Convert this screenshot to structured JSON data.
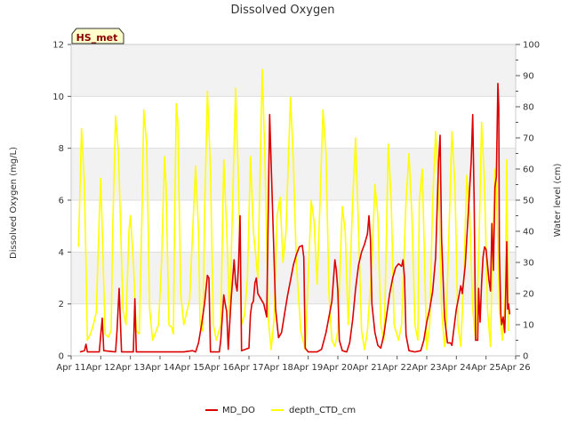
{
  "chart_data": {
    "type": "line",
    "title": "Dissolved Oxygen",
    "badge": "HS_met",
    "ylabel": "Dissolved Oxygen (mg/L)",
    "y2label": "Water level (cm)",
    "ylim": [
      0,
      12
    ],
    "y2lim": [
      0,
      100
    ],
    "xlim": [
      0,
      15
    ],
    "yticks": [
      "0",
      "2",
      "4",
      "6",
      "8",
      "10",
      "12"
    ],
    "y2ticks": [
      "0",
      "10",
      "20",
      "30",
      "40",
      "50",
      "60",
      "70",
      "80",
      "90",
      "100"
    ],
    "xticks": [
      "Apr 11",
      "Apr 12",
      "Apr 13",
      "Apr 14",
      "Apr 15",
      "Apr 16",
      "Apr 17",
      "Apr 18",
      "Apr 19",
      "Apr 20",
      "Apr 21",
      "Apr 22",
      "Apr 23",
      "Apr 24",
      "Apr 25",
      "Apr 26"
    ],
    "legend_position": "bottom-center",
    "series": [
      {
        "name": "MD_DO",
        "axis": "left",
        "color": "#dd0000",
        "points": [
          [
            0.3,
            0.15
          ],
          [
            0.45,
            0.2
          ],
          [
            0.5,
            0.45
          ],
          [
            0.55,
            0.15
          ],
          [
            0.8,
            0.15
          ],
          [
            0.95,
            0.15
          ],
          [
            1.0,
            0.8
          ],
          [
            1.05,
            1.45
          ],
          [
            1.1,
            0.2
          ],
          [
            1.5,
            0.15
          ],
          [
            1.55,
            1.0
          ],
          [
            1.62,
            2.6
          ],
          [
            1.7,
            0.15
          ],
          [
            2.0,
            0.15
          ],
          [
            2.1,
            0.15
          ],
          [
            2.15,
            2.2
          ],
          [
            2.2,
            0.15
          ],
          [
            2.5,
            0.15
          ],
          [
            3.0,
            0.15
          ],
          [
            3.5,
            0.15
          ],
          [
            3.8,
            0.15
          ],
          [
            4.1,
            0.2
          ],
          [
            4.2,
            0.15
          ],
          [
            4.3,
            0.5
          ],
          [
            4.4,
            1.2
          ],
          [
            4.5,
            2.0
          ],
          [
            4.6,
            3.1
          ],
          [
            4.65,
            3.0
          ],
          [
            4.7,
            0.15
          ],
          [
            5.0,
            0.15
          ],
          [
            5.05,
            0.6
          ],
          [
            5.15,
            2.35
          ],
          [
            5.2,
            2.0
          ],
          [
            5.25,
            1.7
          ],
          [
            5.3,
            0.25
          ],
          [
            5.4,
            2.2
          ],
          [
            5.5,
            3.7
          ],
          [
            5.55,
            2.8
          ],
          [
            5.6,
            2.5
          ],
          [
            5.65,
            3.5
          ],
          [
            5.7,
            5.4
          ],
          [
            5.75,
            0.2
          ],
          [
            6.0,
            0.3
          ],
          [
            6.05,
            1.6
          ],
          [
            6.1,
            2.0
          ],
          [
            6.15,
            2.1
          ],
          [
            6.2,
            2.8
          ],
          [
            6.25,
            3.0
          ],
          [
            6.3,
            2.4
          ],
          [
            6.4,
            2.2
          ],
          [
            6.5,
            2.0
          ],
          [
            6.6,
            1.5
          ],
          [
            6.7,
            9.3
          ],
          [
            6.8,
            5.5
          ],
          [
            6.9,
            1.8
          ],
          [
            7.0,
            0.7
          ],
          [
            7.1,
            0.9
          ],
          [
            7.2,
            1.6
          ],
          [
            7.3,
            2.3
          ],
          [
            7.4,
            2.9
          ],
          [
            7.5,
            3.5
          ],
          [
            7.6,
            3.9
          ],
          [
            7.7,
            4.2
          ],
          [
            7.8,
            4.25
          ],
          [
            7.85,
            3.8
          ],
          [
            7.9,
            0.3
          ],
          [
            8.0,
            0.15
          ],
          [
            8.3,
            0.15
          ],
          [
            8.45,
            0.25
          ],
          [
            8.6,
            0.9
          ],
          [
            8.7,
            1.5
          ],
          [
            8.8,
            2.1
          ],
          [
            8.85,
            2.9
          ],
          [
            8.9,
            3.7
          ],
          [
            8.95,
            3.3
          ],
          [
            9.0,
            2.5
          ],
          [
            9.05,
            0.6
          ],
          [
            9.15,
            0.2
          ],
          [
            9.3,
            0.15
          ],
          [
            9.4,
            0.5
          ],
          [
            9.5,
            1.4
          ],
          [
            9.6,
            2.6
          ],
          [
            9.7,
            3.5
          ],
          [
            9.8,
            4.0
          ],
          [
            9.9,
            4.3
          ],
          [
            10.0,
            4.7
          ],
          [
            10.05,
            5.4
          ],
          [
            10.1,
            4.5
          ],
          [
            10.15,
            2.0
          ],
          [
            10.25,
            0.9
          ],
          [
            10.35,
            0.4
          ],
          [
            10.45,
            0.3
          ],
          [
            10.55,
            0.8
          ],
          [
            10.65,
            1.6
          ],
          [
            10.75,
            2.4
          ],
          [
            10.85,
            3.0
          ],
          [
            10.95,
            3.4
          ],
          [
            11.05,
            3.55
          ],
          [
            11.15,
            3.45
          ],
          [
            11.2,
            3.7
          ],
          [
            11.25,
            3.0
          ],
          [
            11.3,
            0.8
          ],
          [
            11.4,
            0.2
          ],
          [
            11.6,
            0.15
          ],
          [
            11.8,
            0.2
          ],
          [
            11.9,
            0.6
          ],
          [
            12.0,
            1.3
          ],
          [
            12.1,
            1.8
          ],
          [
            12.2,
            2.5
          ],
          [
            12.3,
            3.8
          ],
          [
            12.4,
            7.5
          ],
          [
            12.45,
            8.5
          ],
          [
            12.5,
            4.5
          ],
          [
            12.6,
            1.5
          ],
          [
            12.7,
            0.5
          ],
          [
            12.8,
            0.5
          ],
          [
            12.85,
            0.4
          ],
          [
            12.9,
            0.9
          ],
          [
            13.0,
            1.8
          ],
          [
            13.1,
            2.4
          ],
          [
            13.15,
            2.7
          ],
          [
            13.2,
            2.4
          ],
          [
            13.3,
            3.5
          ],
          [
            13.4,
            5.5
          ],
          [
            13.45,
            6.5
          ],
          [
            13.5,
            7.5
          ],
          [
            13.55,
            9.3
          ],
          [
            13.6,
            6.0
          ],
          [
            13.65,
            0.6
          ],
          [
            13.72,
            0.6
          ],
          [
            13.75,
            2.6
          ],
          [
            13.8,
            1.3
          ],
          [
            13.85,
            2.8
          ],
          [
            13.9,
            3.8
          ],
          [
            13.95,
            4.2
          ],
          [
            14.0,
            4.1
          ],
          [
            14.1,
            2.9
          ],
          [
            14.15,
            2.5
          ],
          [
            14.2,
            5.1
          ],
          [
            14.25,
            3.3
          ],
          [
            14.3,
            6.5
          ],
          [
            14.35,
            6.9
          ],
          [
            14.4,
            10.5
          ],
          [
            14.43,
            9.6
          ],
          [
            14.45,
            4.0
          ],
          [
            14.5,
            1.6
          ],
          [
            14.53,
            1.2
          ],
          [
            14.58,
            1.5
          ],
          [
            14.63,
            0.9
          ],
          [
            14.66,
            2.2
          ],
          [
            14.7,
            4.4
          ],
          [
            14.73,
            1.8
          ],
          [
            14.76,
            2.0
          ],
          [
            14.8,
            1.6
          ]
        ]
      },
      {
        "name": "depth_CTD_cm",
        "axis": "right",
        "color": "#ffff00",
        "points": [
          [
            0.25,
            35
          ],
          [
            0.35,
            73
          ],
          [
            0.45,
            55
          ],
          [
            0.55,
            5
          ],
          [
            0.65,
            7
          ],
          [
            0.75,
            10
          ],
          [
            0.85,
            14
          ],
          [
            0.95,
            45
          ],
          [
            1.0,
            57
          ],
          [
            1.05,
            40
          ],
          [
            1.15,
            7
          ],
          [
            1.25,
            6
          ],
          [
            1.35,
            8
          ],
          [
            1.4,
            40
          ],
          [
            1.5,
            77
          ],
          [
            1.6,
            65
          ],
          [
            1.75,
            15
          ],
          [
            1.85,
            10
          ],
          [
            1.95,
            40
          ],
          [
            2.0,
            45
          ],
          [
            2.1,
            30
          ],
          [
            2.2,
            8
          ],
          [
            2.3,
            7
          ],
          [
            2.4,
            50
          ],
          [
            2.45,
            79
          ],
          [
            2.55,
            68
          ],
          [
            2.65,
            15
          ],
          [
            2.75,
            5
          ],
          [
            2.95,
            10
          ],
          [
            3.05,
            30
          ],
          [
            3.15,
            64
          ],
          [
            3.2,
            55
          ],
          [
            3.3,
            10
          ],
          [
            3.4,
            9
          ],
          [
            3.45,
            7
          ],
          [
            3.5,
            50
          ],
          [
            3.55,
            81
          ],
          [
            3.6,
            75
          ],
          [
            3.7,
            20
          ],
          [
            3.8,
            10
          ],
          [
            4.0,
            18
          ],
          [
            4.1,
            40
          ],
          [
            4.2,
            61
          ],
          [
            4.3,
            40
          ],
          [
            4.35,
            10
          ],
          [
            4.45,
            8
          ],
          [
            4.5,
            45
          ],
          [
            4.6,
            85
          ],
          [
            4.7,
            60
          ],
          [
            4.8,
            10
          ],
          [
            4.9,
            5
          ],
          [
            5.05,
            10
          ],
          [
            5.15,
            63
          ],
          [
            5.25,
            40
          ],
          [
            5.35,
            12
          ],
          [
            5.45,
            50
          ],
          [
            5.55,
            86
          ],
          [
            5.65,
            55
          ],
          [
            5.75,
            10
          ],
          [
            5.85,
            13
          ],
          [
            5.95,
            25
          ],
          [
            6.05,
            64
          ],
          [
            6.15,
            40
          ],
          [
            6.3,
            25
          ],
          [
            6.45,
            92
          ],
          [
            6.55,
            60
          ],
          [
            6.65,
            12
          ],
          [
            6.75,
            2
          ],
          [
            6.85,
            12
          ],
          [
            6.95,
            45
          ],
          [
            7.05,
            51
          ],
          [
            7.15,
            30
          ],
          [
            7.25,
            40
          ],
          [
            7.4,
            83
          ],
          [
            7.5,
            62
          ],
          [
            7.6,
            30
          ],
          [
            7.75,
            8
          ],
          [
            7.9,
            2
          ],
          [
            8.0,
            25
          ],
          [
            8.1,
            50
          ],
          [
            8.2,
            43
          ],
          [
            8.3,
            23
          ],
          [
            8.4,
            50
          ],
          [
            8.5,
            79
          ],
          [
            8.6,
            65
          ],
          [
            8.7,
            20
          ],
          [
            8.8,
            5
          ],
          [
            8.9,
            3
          ],
          [
            9.0,
            8
          ],
          [
            9.15,
            48
          ],
          [
            9.25,
            40
          ],
          [
            9.35,
            10
          ],
          [
            9.5,
            50
          ],
          [
            9.6,
            70
          ],
          [
            9.7,
            40
          ],
          [
            9.8,
            8
          ],
          [
            9.9,
            2
          ],
          [
            10.0,
            8
          ],
          [
            10.15,
            30
          ],
          [
            10.25,
            55
          ],
          [
            10.35,
            45
          ],
          [
            10.45,
            10
          ],
          [
            10.55,
            5
          ],
          [
            10.6,
            20
          ],
          [
            10.7,
            68
          ],
          [
            10.8,
            50
          ],
          [
            10.9,
            10
          ],
          [
            11.05,
            5
          ],
          [
            11.15,
            10
          ],
          [
            11.3,
            50
          ],
          [
            11.4,
            65
          ],
          [
            11.5,
            45
          ],
          [
            11.6,
            10
          ],
          [
            11.7,
            5
          ],
          [
            11.75,
            50
          ],
          [
            11.85,
            60
          ],
          [
            11.9,
            40
          ],
          [
            12.0,
            2
          ],
          [
            12.1,
            10
          ],
          [
            12.2,
            50
          ],
          [
            12.3,
            72
          ],
          [
            12.4,
            55
          ],
          [
            12.5,
            15
          ],
          [
            12.6,
            3
          ],
          [
            12.65,
            8
          ],
          [
            12.75,
            40
          ],
          [
            12.85,
            72
          ],
          [
            12.95,
            55
          ],
          [
            13.05,
            10
          ],
          [
            13.15,
            3
          ],
          [
            13.25,
            25
          ],
          [
            13.35,
            58
          ],
          [
            13.45,
            45
          ],
          [
            13.55,
            15
          ],
          [
            13.65,
            5
          ],
          [
            13.75,
            30
          ],
          [
            13.85,
            75
          ],
          [
            13.95,
            55
          ],
          [
            14.05,
            15
          ],
          [
            14.15,
            3
          ],
          [
            14.2,
            25
          ],
          [
            14.3,
            60
          ],
          [
            14.35,
            55
          ],
          [
            14.45,
            15
          ],
          [
            14.55,
            5
          ],
          [
            14.65,
            20
          ],
          [
            14.7,
            63
          ],
          [
            14.75,
            8
          ]
        ]
      }
    ]
  }
}
